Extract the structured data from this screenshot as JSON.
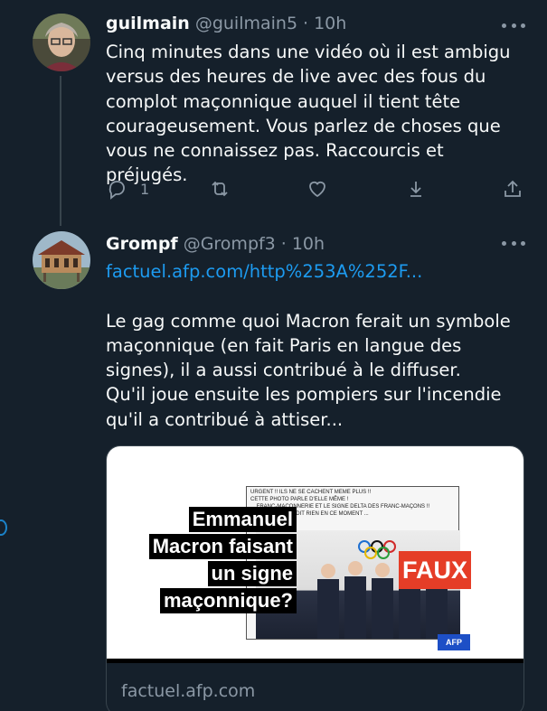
{
  "tweets": [
    {
      "display_name": "guilmain",
      "handle": "@guilmain5",
      "separator": "·",
      "time": "10h",
      "text": "Cinq minutes dans une vidéo où il est ambigu versus des heures de live avec des fous du complot maçonnique auquel il tient tête courageusement. Vous parlez de choses que vous ne connaissez pas. Raccourcis et préjugés.",
      "reply_count": "1",
      "icons": [
        "reply-icon",
        "retweet-icon",
        "like-icon",
        "download-icon",
        "share-icon"
      ]
    },
    {
      "display_name": "Grompf",
      "handle": "@Grompf3",
      "separator": "·",
      "time": "10h",
      "link": "factuel.afp.com/http%253A%252F...",
      "text_line1": "Le gag comme quoi Macron ferait un symbole maçonnique (en fait Paris en langue des signes), il a aussi contribué à le diffuser.",
      "text_line2": "Qu'il joue ensuite les pompiers sur l'incendie qu'il a contribué à attiser...",
      "card": {
        "caption_lines": [
          "Emmanuel",
          "Macron faisant",
          "un signe",
          "maçonnique?"
        ],
        "meme_text": "URGENT !! ILS NE SE CACHENT MEME PLUS !!\nCETTE PHOTO PARLE D'ELLE MÊME !\n... FRANC-MAÇONNERIE ET LE SIGNE DELTA DES FRANC-MAÇONS !!\n... MOT NE VOUS DIT RIEN EN CE MOMENT ...\n... X !!",
        "faux_label": "FAUX",
        "badge": "AFP",
        "domain": "factuel.afp.com"
      }
    }
  ],
  "colors": {
    "background": "#15202b",
    "text": "#f7f9f9",
    "muted": "#8b98a5",
    "link": "#1d9bf0",
    "faux": "#e53d27"
  }
}
